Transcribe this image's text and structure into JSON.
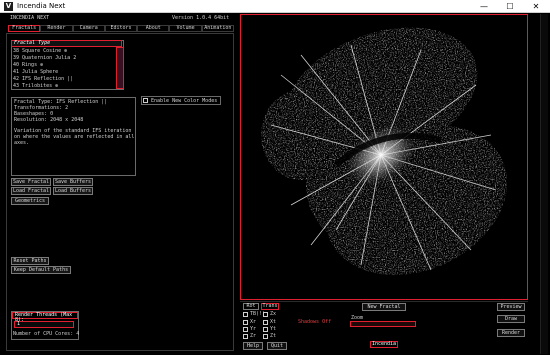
{
  "window": {
    "title": "Incendia Next",
    "minimize": "—",
    "maximize": "☐",
    "close": "✕"
  },
  "app": {
    "name": "INCENDIA NEXT",
    "version": "Version 1.0.4 64bit"
  },
  "menu": [
    "Fractals",
    "Render",
    "Camera",
    "Editors",
    "About",
    "Volume",
    "Animation"
  ],
  "fractal_list": {
    "header": "Fractal Type",
    "items": [
      "38 Square Cosine ⊕",
      "39 Quaternion Julia 2",
      "40 Rings ⊕",
      "41 Julia Sphere",
      "42 IFS Reflection ||",
      "43 Trilobites ⊕"
    ]
  },
  "info": {
    "fractal_type": "Fractal Type: IFS Reflection ||",
    "transformations": "Transformations:   2",
    "baseshapes": "Baseshapes:        0",
    "resolution": "Resolution:   2048 x 2048",
    "desc1": "Variation of the standard IFS iteration",
    "desc2": "on where the values are reflected in all",
    "desc3": "axes."
  },
  "color_modes": "Enable New Color Modes",
  "buttons": {
    "save_fractal": "Save Fractal",
    "save_buffers": "Save Buffers",
    "load_fractal": "Load Fractal",
    "load_buffers": "Load Buffers",
    "geometrics": "Geometrics",
    "reset_paths": "Reset Paths",
    "keep_default_paths": "Keep Default Paths"
  },
  "threads": {
    "label": "Render Threads (Max 8):",
    "value": "1",
    "cpu": "Number of CPU Cores: 4"
  },
  "bottom": {
    "tab_rot": "Rot",
    "tab_trans": "Trans",
    "tbc": "TB(!)",
    "zx": "Zx",
    "xr": "Xr",
    "yr": "Yr",
    "zr": "Zr",
    "xt": "Xt",
    "yt": "Yt",
    "zt": "Zt",
    "help": "Help",
    "quit": "Quit",
    "shadows": "Shadows Off",
    "new_fractal": "New Fractal",
    "zoom": "Zoom",
    "incendia": "Incendia",
    "preview": "Preview",
    "draw": "Draw",
    "render": "Render"
  },
  "colors": {
    "accent": "#e02030",
    "background": "#000000",
    "text": "#d8d8d8"
  }
}
